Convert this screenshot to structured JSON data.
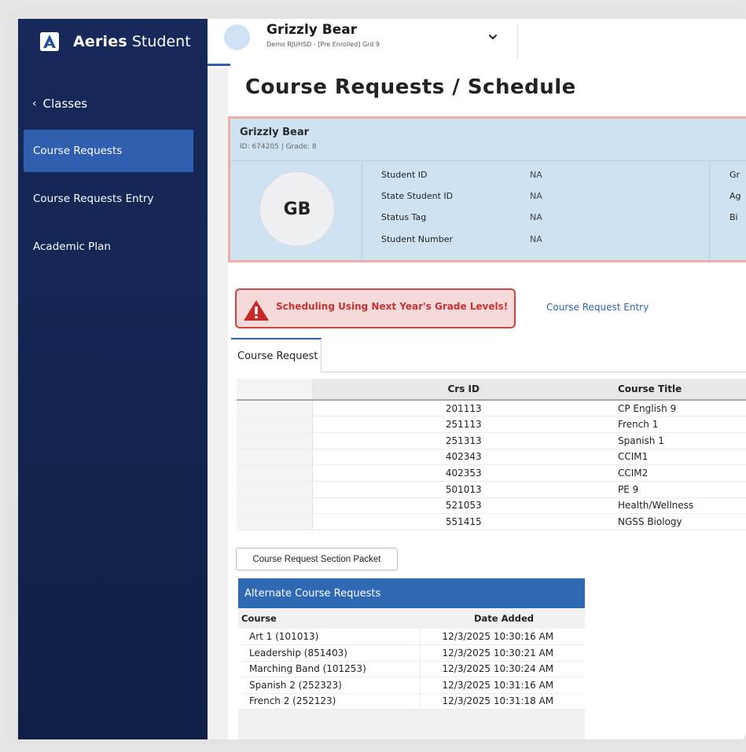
{
  "brand": {
    "bold": "Aeries",
    "light": "Student"
  },
  "sidebar": {
    "back_label": "Classes",
    "items": [
      {
        "label": "Course Requests",
        "active": true
      },
      {
        "label": "Course Requests Entry",
        "active": false
      },
      {
        "label": "Academic Plan",
        "active": false
      }
    ]
  },
  "header": {
    "student_name": "Grizzly Bear",
    "student_sub": "Demo RJUHSD - [Pre Enrolled] Grd 9"
  },
  "page": {
    "title": "Course Requests / Schedule"
  },
  "card": {
    "name": "Grizzly Bear",
    "id_line": "ID: 674205 |  Grade: 8",
    "initials": "GB",
    "fields": [
      {
        "label": "Student ID",
        "value": "NA"
      },
      {
        "label": "State Student ID",
        "value": "NA"
      },
      {
        "label": "Status Tag",
        "value": "NA"
      },
      {
        "label": "Student Number",
        "value": "NA"
      }
    ],
    "cut_labels": [
      "Gr",
      "Ag",
      "Bi"
    ]
  },
  "alert": {
    "text": "Scheduling Using Next Year's Grade Levels!"
  },
  "links": {
    "course_request_entry": "Course Request Entry"
  },
  "tabs": [
    {
      "label": "Course Request"
    }
  ],
  "course_table": {
    "headers": [
      "",
      "Crs ID",
      "Course Title"
    ],
    "rows": [
      {
        "crs_id": "201113",
        "title": "CP English 9"
      },
      {
        "crs_id": "251113",
        "title": "French 1"
      },
      {
        "crs_id": "251313",
        "title": "Spanish 1"
      },
      {
        "crs_id": "402343",
        "title": "CCIM1"
      },
      {
        "crs_id": "402353",
        "title": "CCIM2"
      },
      {
        "crs_id": "501013",
        "title": "PE 9"
      },
      {
        "crs_id": "521053",
        "title": "Health/Wellness"
      },
      {
        "crs_id": "551415",
        "title": "NGSS Biology"
      }
    ]
  },
  "packet_button": "Course Request Section Packet",
  "alternates": {
    "title": "Alternate Course Requests",
    "headers": [
      "Course",
      "Date Added"
    ],
    "rows": [
      {
        "course": "Art 1 (101013)",
        "date": "12/3/2025 10:30:16 AM"
      },
      {
        "course": "Leadership (851403)",
        "date": "12/3/2025 10:30:21 AM"
      },
      {
        "course": "Marching Band (101253)",
        "date": "12/3/2025 10:30:24 AM"
      },
      {
        "course": "Spanish 2 (252323)",
        "date": "12/3/2025 10:31:16 AM"
      },
      {
        "course": "French 2 (252123)",
        "date": "12/3/2025 10:31:18 AM"
      }
    ]
  },
  "colors": {
    "sidebar": "#16295a",
    "accent": "#2f5fae",
    "alert": "#c74646",
    "card": "#cfe2f2"
  }
}
